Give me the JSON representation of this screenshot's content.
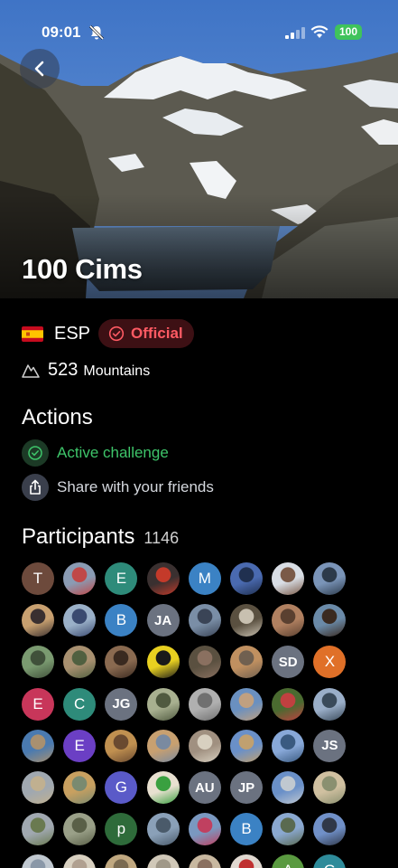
{
  "status_bar": {
    "time": "09:01",
    "battery": "100"
  },
  "hero": {
    "title": "100 Cims"
  },
  "meta": {
    "country": "ESP",
    "badge": "Official",
    "mountain_count": "523",
    "mountain_label": "Mountains"
  },
  "actions": {
    "title": "Actions",
    "active": "Active challenge",
    "share": "Share with your friends"
  },
  "participants": {
    "title": "Participants",
    "count": "1146",
    "avatars": [
      {
        "t": "T",
        "c": "#6d4a3c"
      },
      {
        "p": [
          "#8a9bb3",
          "#c04848"
        ]
      },
      {
        "t": "E",
        "c": "#2e8b7a"
      },
      {
        "p": [
          "#3a3030",
          "#c43a2a"
        ]
      },
      {
        "t": "M",
        "c": "#3b82c4"
      },
      {
        "p": [
          "#4a6ab0",
          "#203050"
        ]
      },
      {
        "p": [
          "#d8dde4",
          "#7a5a48"
        ]
      },
      {
        "p": [
          "#7a94b8",
          "#2c3a4a"
        ]
      },
      {
        "p": [
          "#c8a070",
          "#3a3030"
        ]
      },
      {
        "p": [
          "#9ab0c8",
          "#3a4a70"
        ]
      },
      {
        "t": "B",
        "c": "#3b82c4"
      },
      {
        "t": "JA",
        "c": "#6b7280",
        "i": true
      },
      {
        "p": [
          "#7a8ea6",
          "#3a4456"
        ]
      },
      {
        "p": [
          "#5a5040",
          "#c8c0b0"
        ]
      },
      {
        "p": [
          "#b08060",
          "#5a4030"
        ]
      },
      {
        "p": [
          "#6a8aa8",
          "#3a2a20"
        ]
      },
      {
        "p": [
          "#7a9a70",
          "#40503a"
        ]
      },
      {
        "p": [
          "#a89070",
          "#506040"
        ]
      },
      {
        "p": [
          "#8a6a50",
          "#3a2a20"
        ]
      },
      {
        "p": [
          "#e8d020",
          "#1a1a1a"
        ]
      },
      {
        "p": [
          "#5a5040",
          "#8a7060"
        ]
      },
      {
        "p": [
          "#c09060",
          "#706050"
        ]
      },
      {
        "t": "SD",
        "c": "#6b7280",
        "i": true
      },
      {
        "t": "X",
        "c": "#e07028"
      },
      {
        "t": "E",
        "c": "#c8365a"
      },
      {
        "t": "C",
        "c": "#2e8b7a"
      },
      {
        "t": "JG",
        "c": "#6b7280",
        "i": true
      },
      {
        "p": [
          "#a8b090",
          "#505a40"
        ]
      },
      {
        "p": [
          "#b0b0b0",
          "#707070"
        ]
      },
      {
        "p": [
          "#6a90c0",
          "#c0a080"
        ]
      },
      {
        "p": [
          "#4a6a30",
          "#c04040"
        ]
      },
      {
        "p": [
          "#9aaec8",
          "#3a4a5a"
        ]
      },
      {
        "p": [
          "#4a7ab0",
          "#a89070"
        ]
      },
      {
        "t": "E",
        "c": "#6b3fc4"
      },
      {
        "p": [
          "#c09050",
          "#6a4a30"
        ]
      },
      {
        "p": [
          "#c8a070",
          "#7a8aa0"
        ]
      },
      {
        "p": [
          "#a09080",
          "#d8d0c0"
        ]
      },
      {
        "p": [
          "#6a90c8",
          "#c0a070"
        ]
      },
      {
        "p": [
          "#88a8d8",
          "#3a5a80"
        ]
      },
      {
        "t": "JS",
        "c": "#6b7280",
        "i": true
      },
      {
        "p": [
          "#a0a8b0",
          "#c0b090"
        ]
      },
      {
        "p": [
          "#c8a060",
          "#7a8a70"
        ]
      },
      {
        "t": "G",
        "c": "#5a5ac8"
      },
      {
        "p": [
          "#e8e0d0",
          "#3aa040"
        ]
      },
      {
        "t": "AU",
        "c": "#6b7280",
        "i": true
      },
      {
        "t": "JP",
        "c": "#6b7280",
        "i": true
      },
      {
        "p": [
          "#6a90c8",
          "#c0c8d0"
        ]
      },
      {
        "p": [
          "#d0c0a0",
          "#8a9070"
        ]
      },
      {
        "p": [
          "#a0a8b0",
          "#6a7a50"
        ]
      },
      {
        "p": [
          "#9aa088",
          "#5a6048"
        ]
      },
      {
        "t": "p",
        "c": "#2e6b3a"
      },
      {
        "p": [
          "#8aa0b8",
          "#4a5a6a"
        ]
      },
      {
        "p": [
          "#7a98c0",
          "#c04060"
        ]
      },
      {
        "t": "B",
        "c": "#3b82c4"
      },
      {
        "p": [
          "#8aa8d0",
          "#5a6a50"
        ]
      },
      {
        "p": [
          "#7090c8",
          "#303848"
        ]
      },
      {
        "p": [
          "#c0c8d0",
          "#8a98a8"
        ]
      },
      {
        "p": [
          "#d8d0c0",
          "#b0a090"
        ]
      },
      {
        "p": [
          "#c0a880",
          "#7a6a50"
        ]
      },
      {
        "p": [
          "#d0c8b8",
          "#a09888"
        ]
      },
      {
        "p": [
          "#c8b8a0",
          "#8a7060"
        ]
      },
      {
        "p": [
          "#e0d8d0",
          "#c03030"
        ]
      },
      {
        "t": "A",
        "c": "#5a9a40"
      },
      {
        "t": "G",
        "c": "#2e8b9a"
      }
    ]
  }
}
